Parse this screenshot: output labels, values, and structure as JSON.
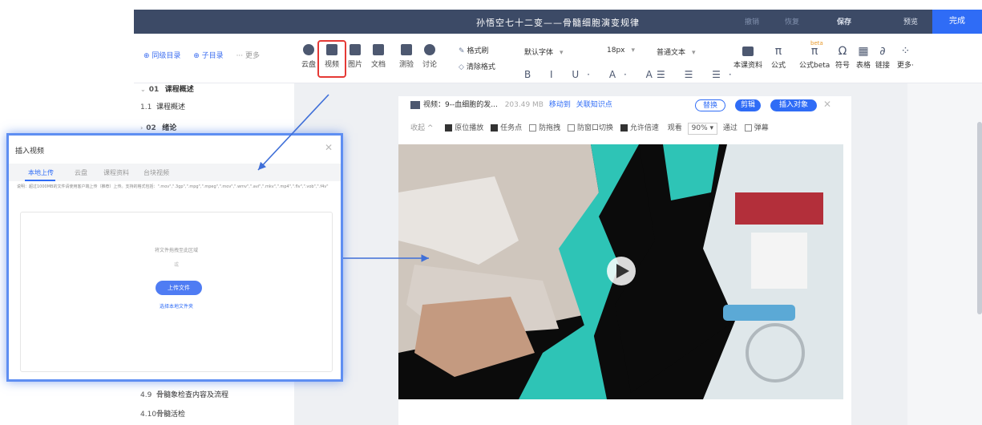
{
  "header": {
    "title": "孙悟空七十二变——骨髓细胞演变规律",
    "undo": "撤销",
    "redo": "恢复",
    "save": "保存",
    "preview": "预览",
    "done": "完成"
  },
  "toolbar": {
    "nav": {
      "same_level": "⊕ 同级目录",
      "sub_level": "⊕ 子目录",
      "more": "··· 更多"
    },
    "media": [
      "云盘",
      "视频",
      "图片",
      "文档",
      "测验",
      "讨论"
    ],
    "format_brush": "格式刷",
    "clear_format": "清除格式",
    "font": "默认字体",
    "font_size": "18px",
    "paragraph": "普通文本",
    "text_row": "B I U· A· A·",
    "list_row": "☰ ☰ ☰·",
    "right": {
      "resources": "本课资料",
      "formula": "公式",
      "formula_beta": "公式beta",
      "beta_tag": "beta",
      "symbol": "符号",
      "table": "表格",
      "link": "链接",
      "more": "更多·"
    }
  },
  "sidebar": {
    "items": [
      {
        "num": "01",
        "label": "课程概述"
      },
      {
        "num": "1.1",
        "label": "课程概述"
      },
      {
        "num": "02",
        "label": "绪论"
      },
      {
        "num": "4.9",
        "label": "骨髓象检查内容及流程"
      },
      {
        "num": "4.10",
        "label": "骨髓活检"
      }
    ]
  },
  "video_block": {
    "name": "视频：9--血细胞的发...",
    "size": "203.49 MB",
    "move_to": "移动到",
    "link_points": "关联知识点",
    "replace": "替换",
    "cut": "剪辑",
    "insert_object": "插入对象",
    "collapse": "收起 ^",
    "options": [
      "原位播放",
      "任务点",
      "防拖拽",
      "防窗口切换",
      "允许倍速"
    ],
    "options_checked": [
      true,
      true,
      false,
      false,
      true
    ],
    "watch_label": "观看",
    "watch_percent": "90%",
    "pass_label": "通过",
    "danmaku": "弹幕",
    "danmaku_checked": false
  },
  "dialog": {
    "title": "插入视频",
    "tabs": [
      "本地上传",
      "云盘",
      "课程资料",
      "台块视频"
    ],
    "active_tab": 0,
    "hint": "说明：超过1000MB的文件请使用客户端上传（推荐）上传。支持的格式包括：\".mov\",\".3gp\",\".mpg\",\".mpeg\",\".mov\",\".wmv\",\".avi\",\".mkv\",\".mp4\",\".flv\",\".vob\",\".f4v\"",
    "drop_text": "将文件拖拽至此区域",
    "or": "或",
    "upload": "上传文件",
    "choose_folder": "选择本地文件夹"
  },
  "colors": {
    "accent": "#2f6cf6",
    "header_bg": "#3c4a66",
    "highlight_red": "#e53935",
    "teal": "#2ec4b6"
  }
}
